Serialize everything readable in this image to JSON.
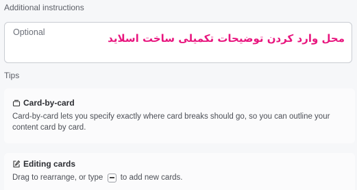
{
  "additional_instructions": {
    "label": "Additional instructions",
    "placeholder": "Optional",
    "annotation": "محل وارد کردن توضیحات تکمیلی ساخت اسلاید"
  },
  "tips": {
    "label": "Tips",
    "cards": [
      {
        "icon": "card-icon",
        "title": "Card-by-card",
        "body": "Card-by-card lets you specify exactly where card breaks should go, so you can outline your content card by card."
      },
      {
        "icon": "edit-icon",
        "title": "Editing cards",
        "body_before": "Drag to rearrange, or type ",
        "key": "---",
        "body_after": " to add new cards."
      }
    ]
  },
  "colors": {
    "annotation": "#e8157e",
    "background": "#f6f7f9"
  }
}
